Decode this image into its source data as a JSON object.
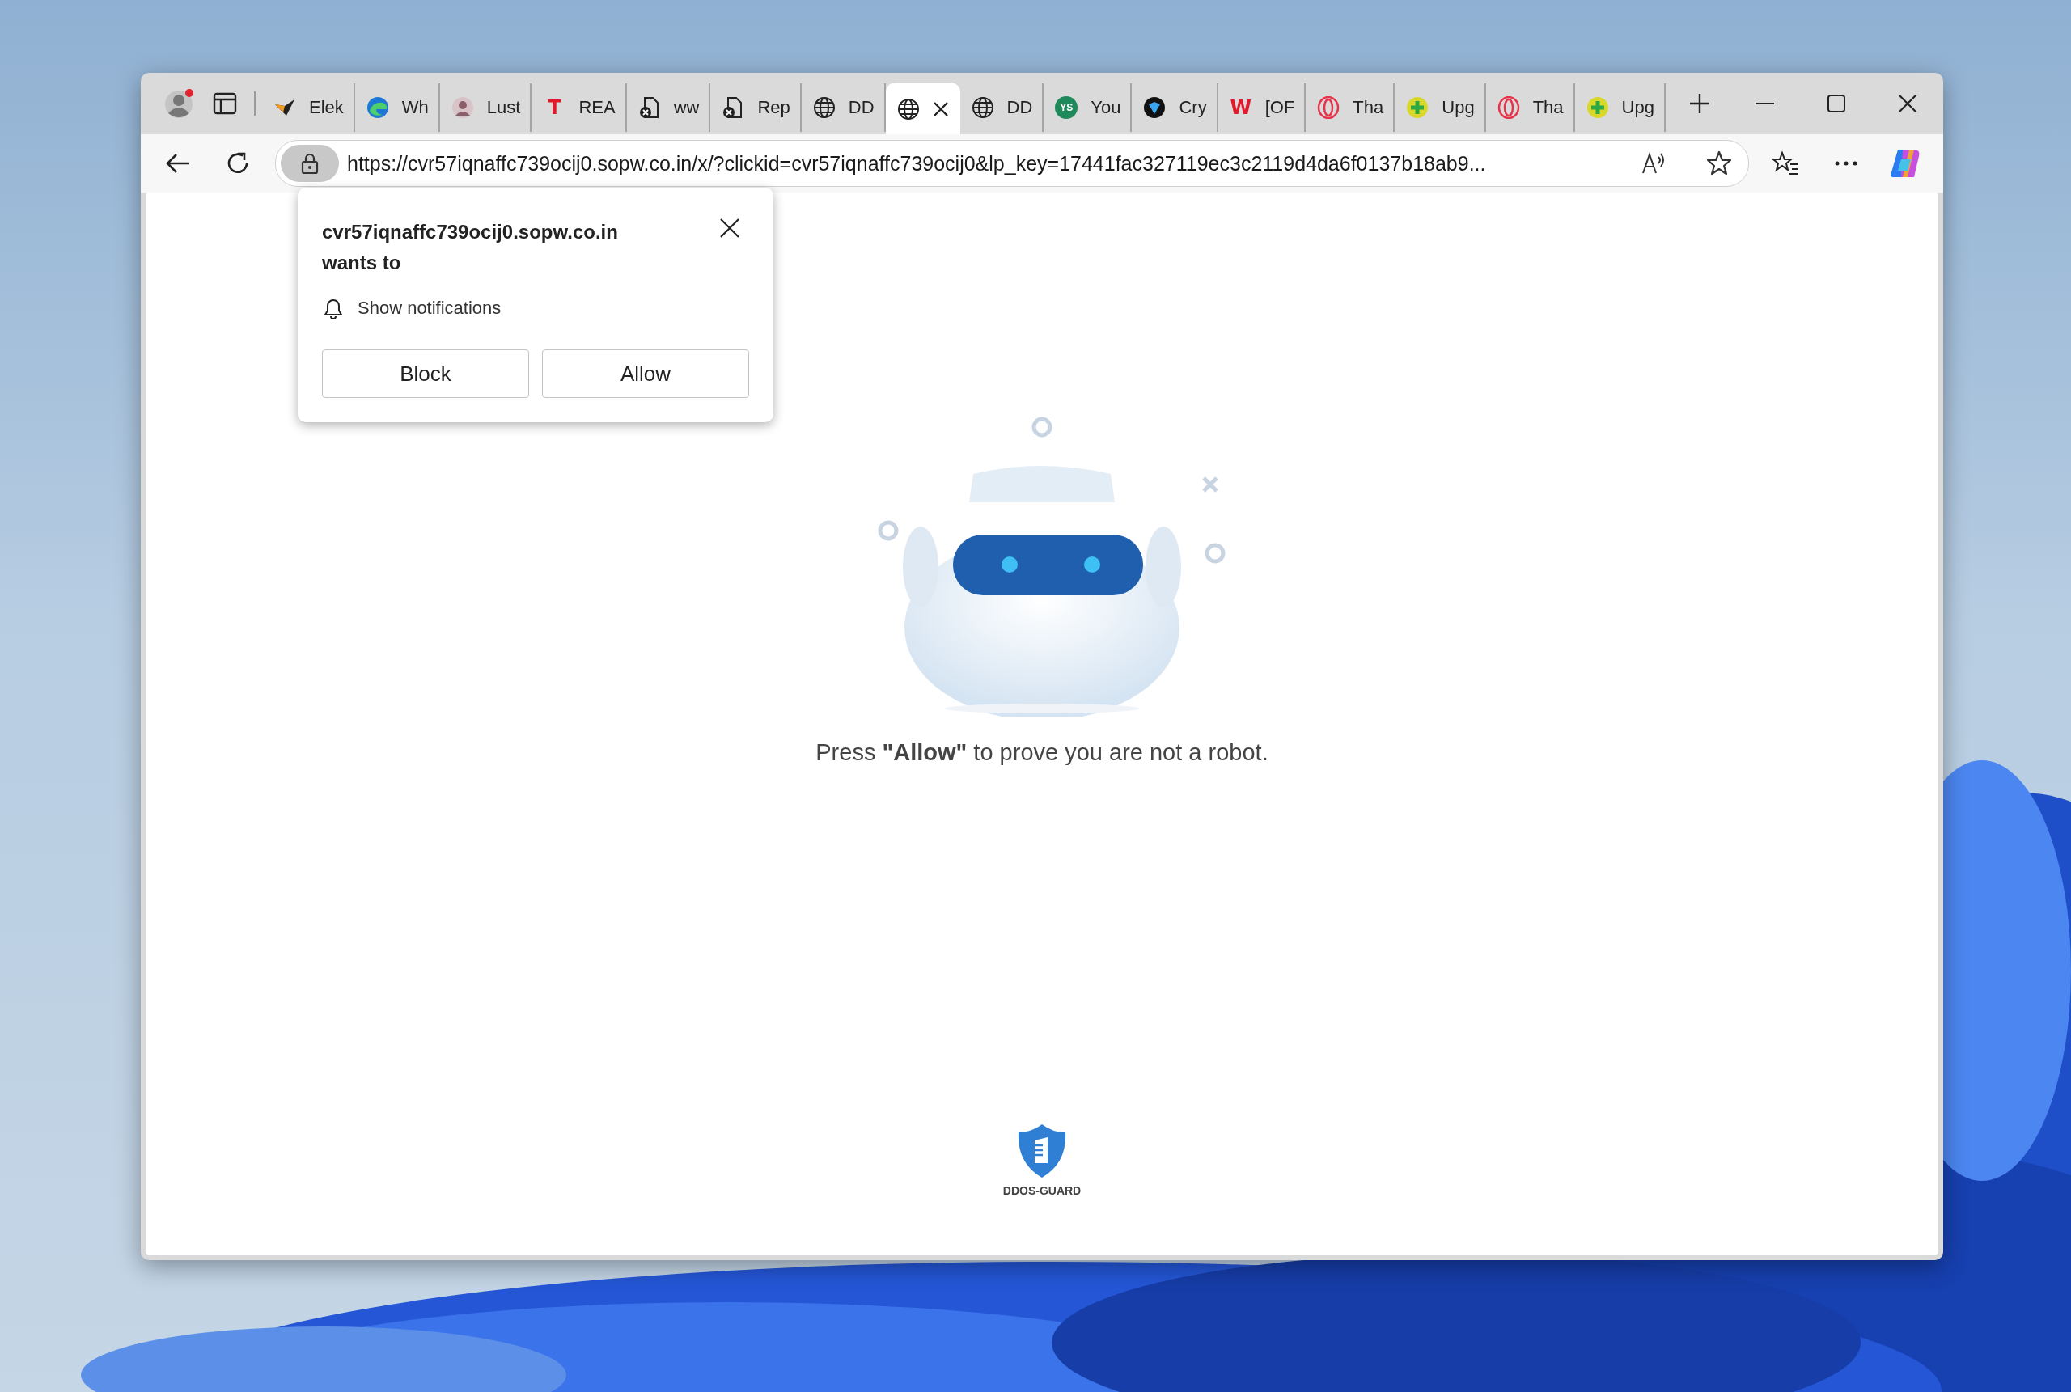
{
  "tabs": [
    {
      "kind": "bird",
      "label": "Elek",
      "selected": false
    },
    {
      "kind": "swirl",
      "label": "Wh",
      "selected": false
    },
    {
      "kind": "avatar",
      "label": "Lust",
      "selected": false
    },
    {
      "kind": "letter",
      "icon_text": "T",
      "label": "REA",
      "selected": false
    },
    {
      "kind": "doc-error",
      "label": "ww",
      "selected": false
    },
    {
      "kind": "doc-error",
      "label": "Rep",
      "selected": false
    },
    {
      "kind": "globe",
      "label": "DD",
      "selected": false
    },
    {
      "kind": "globe",
      "selected": true
    },
    {
      "kind": "globe",
      "label": "DD",
      "selected": false
    },
    {
      "kind": "badge",
      "icon_text": "YS",
      "label": "You",
      "selected": false
    },
    {
      "kind": "diamond",
      "label": "Cry",
      "selected": false
    },
    {
      "kind": "letter",
      "icon_text": "W",
      "label": "[OF",
      "selected": false
    },
    {
      "kind": "ring",
      "label": "Tha",
      "selected": false
    },
    {
      "kind": "plus",
      "label": "Upg",
      "selected": false
    },
    {
      "kind": "ring",
      "label": "Tha",
      "selected": false
    },
    {
      "kind": "plus",
      "label": "Upg",
      "selected": false
    }
  ],
  "address_bar": {
    "url": "https://cvr57iqnaffc739ocij0.sopw.co.in/x/?clickid=cvr57iqnaffc739ocij0&lp_key=17441fac327119ec3c2119d4da6f0137b18ab9..."
  },
  "permission_popup": {
    "origin": "cvr57iqnaffc739ocij0.sopw.co.in",
    "request": "wants to",
    "permission": "Show notifications",
    "buttons": [
      "Block",
      "Allow"
    ]
  },
  "page": {
    "message": "Press **\"Allow\"** to prove you are not a robot.",
    "logo_caption": "DDOS-GUARD"
  }
}
